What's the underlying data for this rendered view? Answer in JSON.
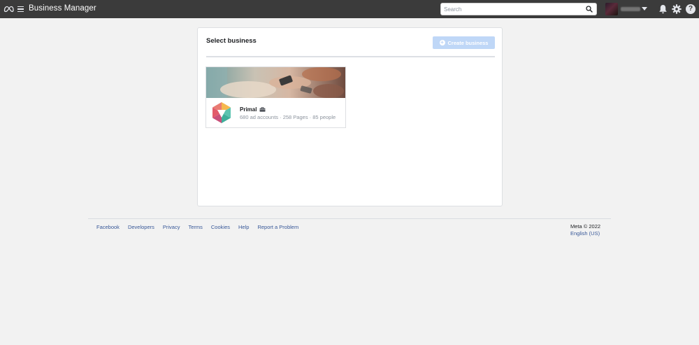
{
  "header": {
    "app_title": "Business Manager",
    "search_placeholder": "Search",
    "help_symbol": "?"
  },
  "panel": {
    "title": "Select business",
    "create_button_label": "Create business"
  },
  "businesses": [
    {
      "name": "Primal",
      "stats": "680 ad accounts · 258 Pages · 85 people"
    }
  ],
  "footer": {
    "links": [
      "Facebook",
      "Developers",
      "Privacy",
      "Terms",
      "Cookies",
      "Help",
      "Report a Problem"
    ],
    "copyright": "Meta © 2022",
    "language": "English (US)"
  },
  "colors": {
    "topbar": "#3b3b3b",
    "page_background": "#f2f2f2",
    "create_button_disabled": "#bfd7f7",
    "link": "#385898"
  },
  "icons": [
    "meta-logo-icon",
    "menu-icon",
    "search-icon",
    "caret-down-icon",
    "bell-icon",
    "gear-icon",
    "help-icon",
    "plus-icon",
    "briefcase-icon"
  ]
}
